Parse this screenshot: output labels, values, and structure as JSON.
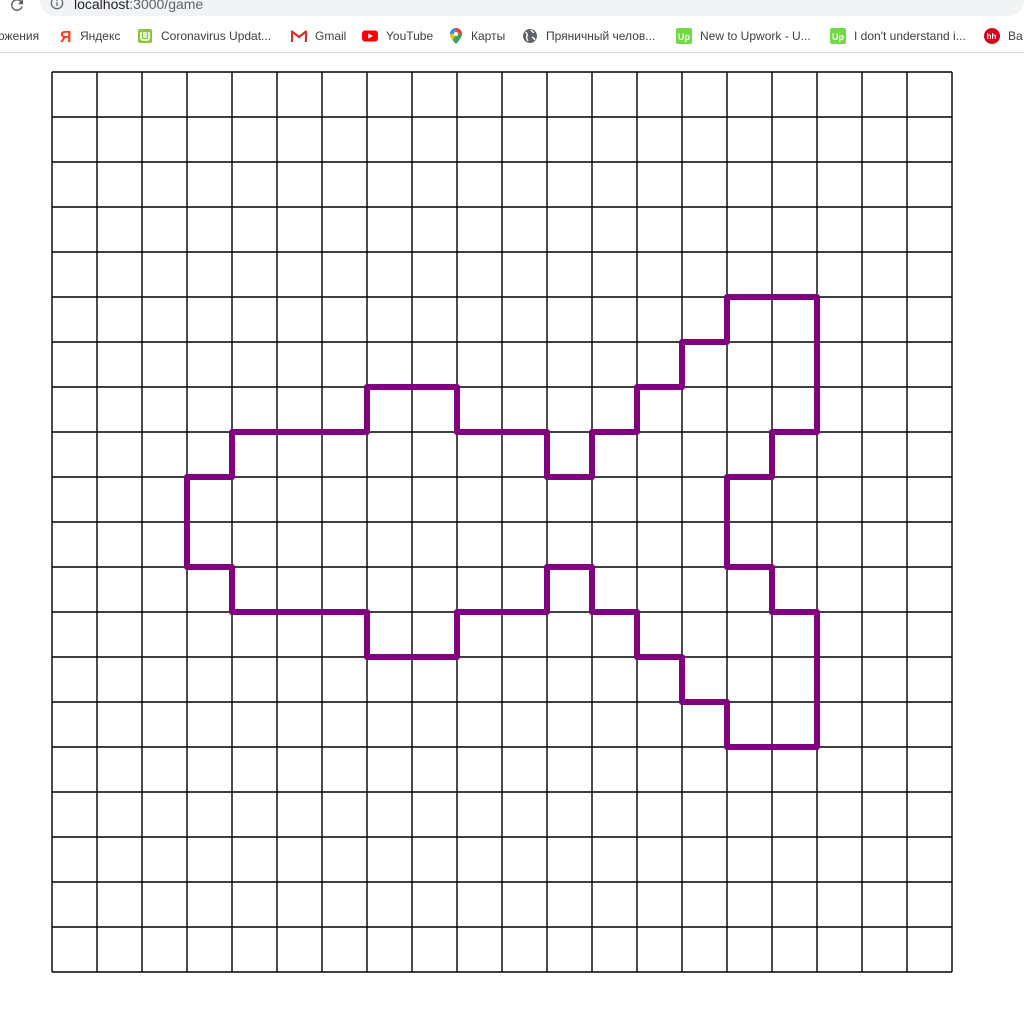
{
  "browser": {
    "url_host": "localhost",
    "url_path": ":3000/game"
  },
  "bookmarks": [
    {
      "label": "ожения",
      "icon": "apps-text-fragment"
    },
    {
      "label": "Яндекс",
      "icon": "yandex-icon"
    },
    {
      "label": "Coronavirus Updat...",
      "icon": "coronavirus-site-icon"
    },
    {
      "label": "Gmail",
      "icon": "gmail-icon"
    },
    {
      "label": "YouTube",
      "icon": "youtube-icon"
    },
    {
      "label": "Карты",
      "icon": "maps-icon"
    },
    {
      "label": "Пряничный челов...",
      "icon": "globe-icon"
    },
    {
      "label": "New to Upwork - U...",
      "icon": "upwork-icon"
    },
    {
      "label": "I don't understand i...",
      "icon": "upwork-icon"
    },
    {
      "label": "Ва",
      "icon": "hh-icon"
    }
  ],
  "game": {
    "grid_cols": 20,
    "grid_rows": 20,
    "grid_line_color": "#000000",
    "path_color": "#800080",
    "path_vertices": [
      [
        15,
        5
      ],
      [
        17,
        5
      ],
      [
        17,
        8
      ],
      [
        16,
        8
      ],
      [
        16,
        9
      ],
      [
        15,
        9
      ],
      [
        15,
        11
      ],
      [
        16,
        11
      ],
      [
        16,
        12
      ],
      [
        17,
        12
      ],
      [
        17,
        15
      ],
      [
        15,
        15
      ],
      [
        15,
        14
      ],
      [
        14,
        14
      ],
      [
        14,
        13
      ],
      [
        13,
        13
      ],
      [
        13,
        12
      ],
      [
        12,
        12
      ],
      [
        12,
        11
      ],
      [
        11,
        11
      ],
      [
        11,
        12
      ],
      [
        9,
        12
      ],
      [
        9,
        13
      ],
      [
        7,
        13
      ],
      [
        7,
        12
      ],
      [
        4,
        12
      ],
      [
        4,
        11
      ],
      [
        3,
        11
      ],
      [
        3,
        9
      ],
      [
        4,
        9
      ],
      [
        4,
        8
      ],
      [
        7,
        8
      ],
      [
        7,
        7
      ],
      [
        9,
        7
      ],
      [
        9,
        8
      ],
      [
        11,
        8
      ],
      [
        11,
        9
      ],
      [
        12,
        9
      ],
      [
        12,
        8
      ],
      [
        13,
        8
      ],
      [
        13,
        7
      ],
      [
        14,
        7
      ],
      [
        14,
        6
      ],
      [
        15,
        6
      ]
    ]
  }
}
